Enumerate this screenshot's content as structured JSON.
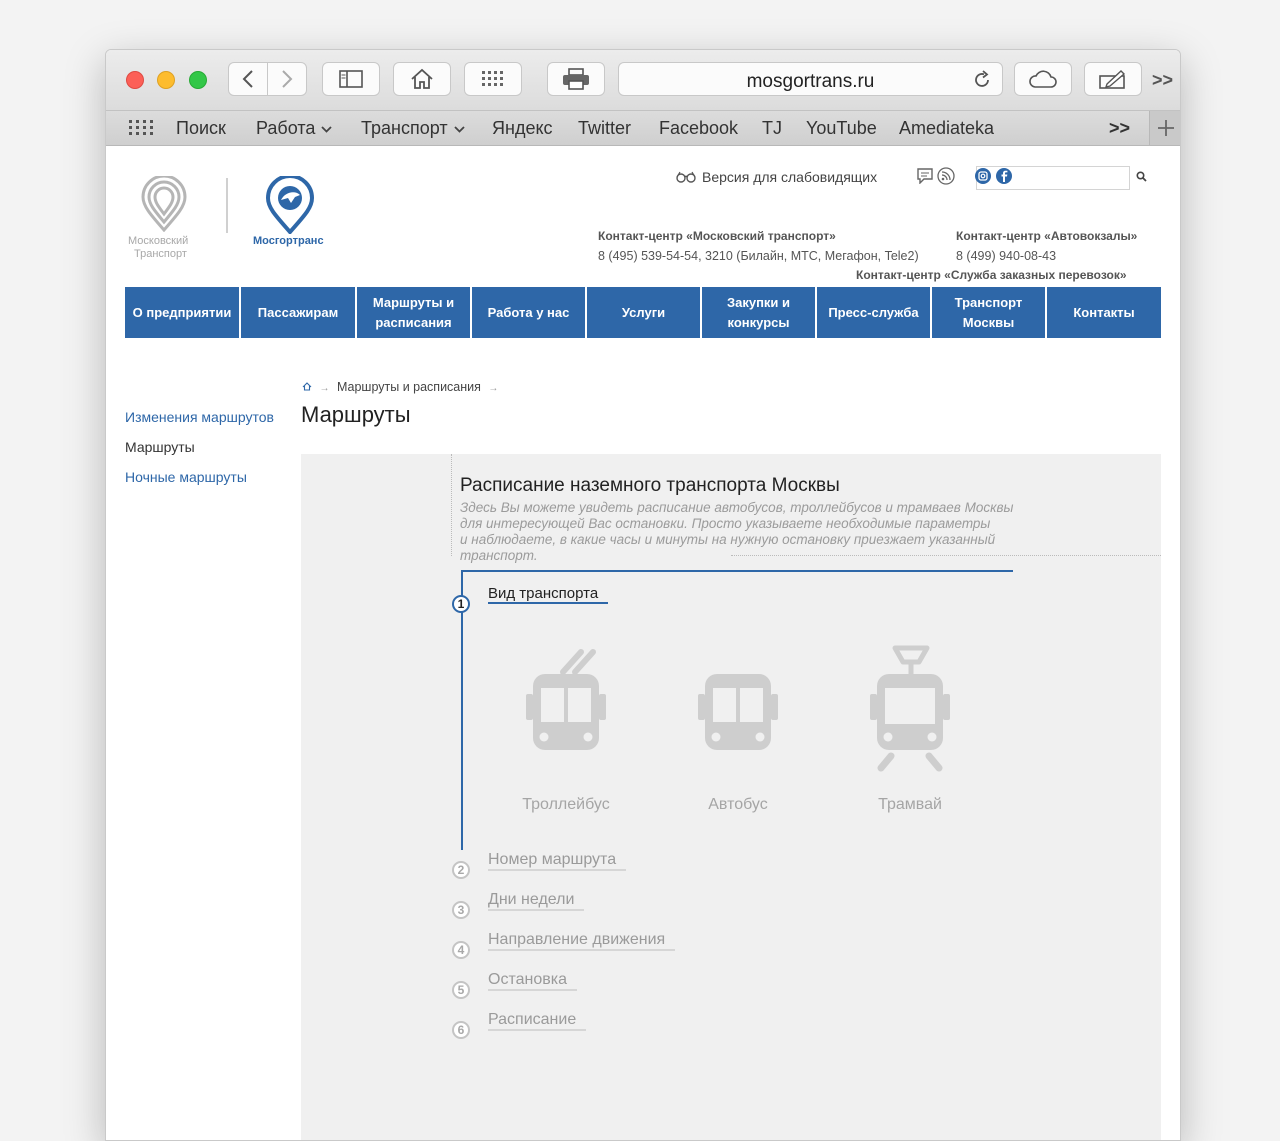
{
  "browser": {
    "url": "mosgortrans.ru",
    "bookmarks": [
      "Поиск",
      "Работа",
      "Транспорт",
      "Яндекс",
      "Twitter",
      "Facebook",
      "TJ",
      "YouTube",
      "Amediateka"
    ],
    "more": ">>"
  },
  "header": {
    "logo_mt_line1": "Московский",
    "logo_mt_line2": "Транспорт",
    "logo_mgt": "Мосгортранс",
    "accessibility": "Версия для слабовидящих",
    "contact1_title": "Контакт-центр «Московский транспорт»",
    "contact1_phone": "8 (495) 539-54-54, 3210 (Билайн, МТС, Мегафон, Tele2)",
    "contact2_title": "Контакт-центр «Автовокзалы»",
    "contact2_phone": "8 (499) 940-08-43",
    "contact3_title": "Контакт-центр «Служба заказных перевозок»"
  },
  "nav": [
    "О предприятии",
    "Пассажирам",
    "Маршруты и расписания",
    "Работа у нас",
    "Услуги",
    "Закупки и конкурсы",
    "Пресс-служба",
    "Транспорт Москвы",
    "Контакты"
  ],
  "breadcrumb": {
    "item": "Маршруты и расписания"
  },
  "page_title": "Маршруты",
  "sidebar": [
    {
      "label": "Изменения маршрутов",
      "active": false
    },
    {
      "label": "Маршруты",
      "active": true
    },
    {
      "label": "Ночные маршруты",
      "active": false
    }
  ],
  "schedule": {
    "title": "Расписание наземного транспорта Москвы",
    "description_lines": [
      "Здесь Вы можете увидеть расписание автобусов, троллейбусов и трамваев Москвы",
      "для интересующей Вас остановки. Просто указываете необходимые параметры",
      "и наблюдаете, в какие часы и минуты на нужную остановку приезжает указанный",
      "транспорт."
    ],
    "steps": [
      {
        "num": "1",
        "label": "Вид транспорта"
      },
      {
        "num": "2",
        "label": "Номер маршрута"
      },
      {
        "num": "3",
        "label": "Дни недели"
      },
      {
        "num": "4",
        "label": "Направление движения"
      },
      {
        "num": "5",
        "label": "Остановка"
      },
      {
        "num": "6",
        "label": "Расписание"
      }
    ],
    "vehicles": [
      "Троллейбус",
      "Автобус",
      "Трамвай"
    ]
  },
  "colors": {
    "brand_blue": "#2e67a8",
    "nav_blue": "#2e67a8",
    "panel_gray": "#f0f0f0"
  }
}
